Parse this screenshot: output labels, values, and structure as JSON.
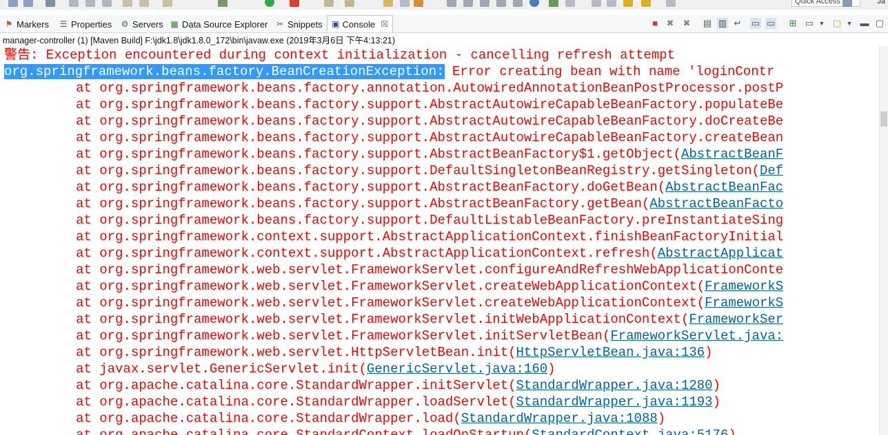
{
  "toolbar": {
    "quick_access_placeholder": "Quick Access",
    "perspective_label": "Ja"
  },
  "tabs": [
    {
      "label": "Markers",
      "icon": "markers-icon"
    },
    {
      "label": "Properties",
      "icon": "properties-icon"
    },
    {
      "label": "Servers",
      "icon": "servers-icon"
    },
    {
      "label": "Data Source Explorer",
      "icon": "data-source-icon"
    },
    {
      "label": "Snippets",
      "icon": "snippets-icon"
    },
    {
      "label": "Console",
      "icon": "console-icon",
      "active": true,
      "close": "☒"
    }
  ],
  "console": {
    "process_info": "manager-controller (1) [Maven Build] F:\\jdk1.8\\jdk1.8.0_172\\bin\\javaw.exe (2019年3月6日 下午4:13:21)",
    "warning_line": "警告: Exception encountered during context initialization - cancelling refresh attempt",
    "exception_class": "org.springframework.beans.factory.BeanCreationException:",
    "exception_message": " Error creating bean with name 'loginContr",
    "trace": [
      {
        "text": "at org.springframework.beans.factory.annotation.AutowiredAnnotationBeanPostProcessor.postP",
        "link": ""
      },
      {
        "text": "at org.springframework.beans.factory.support.AbstractAutowireCapableBeanFactory.populateBe",
        "link": ""
      },
      {
        "text": "at org.springframework.beans.factory.support.AbstractAutowireCapableBeanFactory.doCreateBe",
        "link": ""
      },
      {
        "text": "at org.springframework.beans.factory.support.AbstractAutowireCapableBeanFactory.createBean",
        "link": ""
      },
      {
        "text": "at org.springframework.beans.factory.support.AbstractBeanFactory$1.getObject(",
        "link": "AbstractBeanF"
      },
      {
        "text": "at org.springframework.beans.factory.support.DefaultSingletonBeanRegistry.getSingleton(",
        "link": "Def"
      },
      {
        "text": "at org.springframework.beans.factory.support.AbstractBeanFactory.doGetBean(",
        "link": "AbstractBeanFac"
      },
      {
        "text": "at org.springframework.beans.factory.support.AbstractBeanFactory.getBean(",
        "link": "AbstractBeanFacto"
      },
      {
        "text": "at org.springframework.beans.factory.support.DefaultListableBeanFactory.preInstantiateSing",
        "link": ""
      },
      {
        "text": "at org.springframework.context.support.AbstractApplicationContext.finishBeanFactoryInitial",
        "link": ""
      },
      {
        "text": "at org.springframework.context.support.AbstractApplicationContext.refresh(",
        "link": "AbstractApplicat"
      },
      {
        "text": "at org.springframework.web.servlet.FrameworkServlet.configureAndRefreshWebApplicationConte",
        "link": ""
      },
      {
        "text": "at org.springframework.web.servlet.FrameworkServlet.createWebApplicationContext(",
        "link": "FrameworkS"
      },
      {
        "text": "at org.springframework.web.servlet.FrameworkServlet.createWebApplicationContext(",
        "link": "FrameworkS"
      },
      {
        "text": "at org.springframework.web.servlet.FrameworkServlet.initWebApplicationContext(",
        "link": "FrameworkSer"
      },
      {
        "text": "at org.springframework.web.servlet.FrameworkServlet.initServletBean(",
        "link": "FrameworkServlet.java:"
      },
      {
        "text": "at org.springframework.web.servlet.HttpServletBean.init(",
        "link": "HttpServletBean.java:136",
        "close": ")"
      },
      {
        "text": "at javax.servlet.GenericServlet.init(",
        "link": "GenericServlet.java:160",
        "close": ")"
      },
      {
        "text": "at org.apache.catalina.core.StandardWrapper.initServlet(",
        "link": "StandardWrapper.java:1280",
        "close": ")"
      },
      {
        "text": "at org.apache.catalina.core.StandardWrapper.loadServlet(",
        "link": "StandardWrapper.java:1193",
        "close": ")"
      },
      {
        "text": "at org.apache.catalina.core.StandardWrapper.load(",
        "link": "StandardWrapper.java:1088",
        "close": ")"
      },
      {
        "text": "at org.apache.catalina.core.StandardContext.loadOnStartup(",
        "link": "StandardContext.java:5176",
        "close": ")"
      }
    ]
  },
  "colors": {
    "error": "#ff0000",
    "link": "#0063b0",
    "selection": "#3399ff"
  }
}
